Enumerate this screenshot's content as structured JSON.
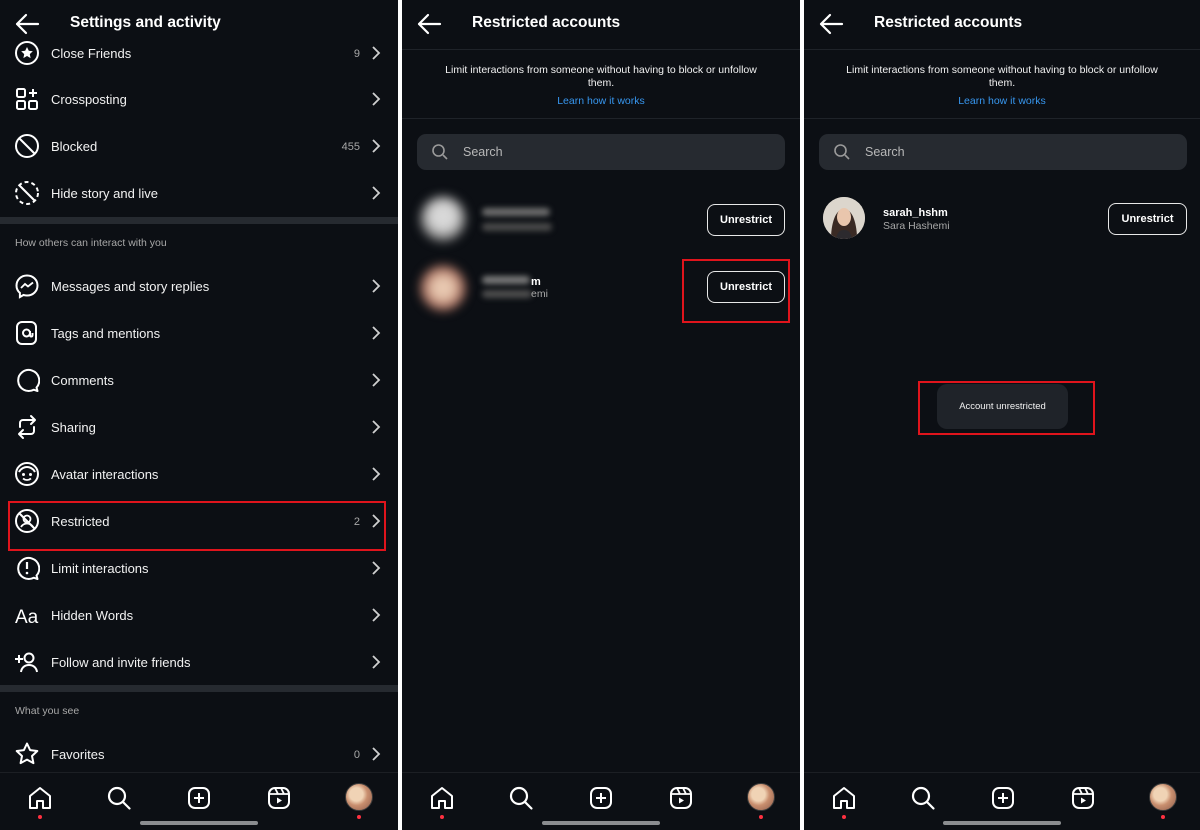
{
  "panel1": {
    "title": "Settings and activity",
    "items_top": [
      {
        "label": "Close Friends",
        "count": "9"
      },
      {
        "label": "Crossposting",
        "count": ""
      },
      {
        "label": "Blocked",
        "count": "455"
      },
      {
        "label": "Hide story and live",
        "count": ""
      }
    ],
    "section_interact": "How others can interact with you",
    "items_interact": [
      {
        "label": "Messages and story replies",
        "count": ""
      },
      {
        "label": "Tags and mentions",
        "count": ""
      },
      {
        "label": "Comments",
        "count": ""
      },
      {
        "label": "Sharing",
        "count": ""
      },
      {
        "label": "Avatar interactions",
        "count": ""
      },
      {
        "label": "Restricted",
        "count": "2"
      },
      {
        "label": "Limit interactions",
        "count": ""
      },
      {
        "label": "Hidden Words",
        "count": ""
      },
      {
        "label": "Follow and invite friends",
        "count": ""
      }
    ],
    "section_see": "What you see",
    "items_see": [
      {
        "label": "Favorites",
        "count": "0"
      }
    ]
  },
  "restricted": {
    "title": "Restricted accounts",
    "description": "Limit interactions from someone without having to block or unfollow them.",
    "learn_link": "Learn how it works",
    "search_placeholder": "Search",
    "unrestrict_label": "Unrestrict"
  },
  "panel2": {
    "partial_user_tail": "m",
    "partial_name_tail": "emi"
  },
  "panel3": {
    "username": "sarah_hshm",
    "fullname": "Sara Hashemi",
    "toast": "Account unrestricted"
  },
  "icons": {
    "nav": [
      "home-icon",
      "search-icon",
      "create-icon",
      "reels-icon",
      "profile-avatar"
    ]
  },
  "colors": {
    "background": "#0c0f14",
    "link": "#3797f0",
    "highlight": "#e0141c",
    "notification_dot": "#ff3040"
  }
}
